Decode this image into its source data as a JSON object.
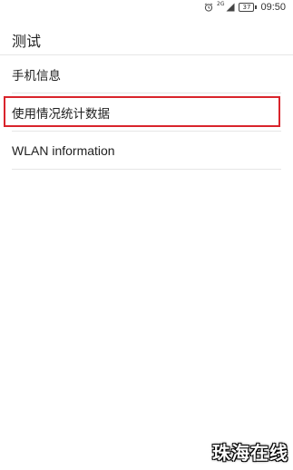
{
  "status_bar": {
    "network_type": "2G",
    "battery_level": "37",
    "time": "09:50"
  },
  "header": {
    "title": "测试"
  },
  "list": {
    "items": [
      {
        "label": "手机信息"
      },
      {
        "label": "使用情况统计数据",
        "highlighted": true
      },
      {
        "label": "WLAN information"
      }
    ]
  },
  "highlight_color": "#d9242c",
  "watermark": {
    "text": "珠海在线"
  },
  "icons": {
    "alarm": "alarm-clock-icon",
    "signal": "signal-strength-icon",
    "battery": "battery-icon"
  }
}
